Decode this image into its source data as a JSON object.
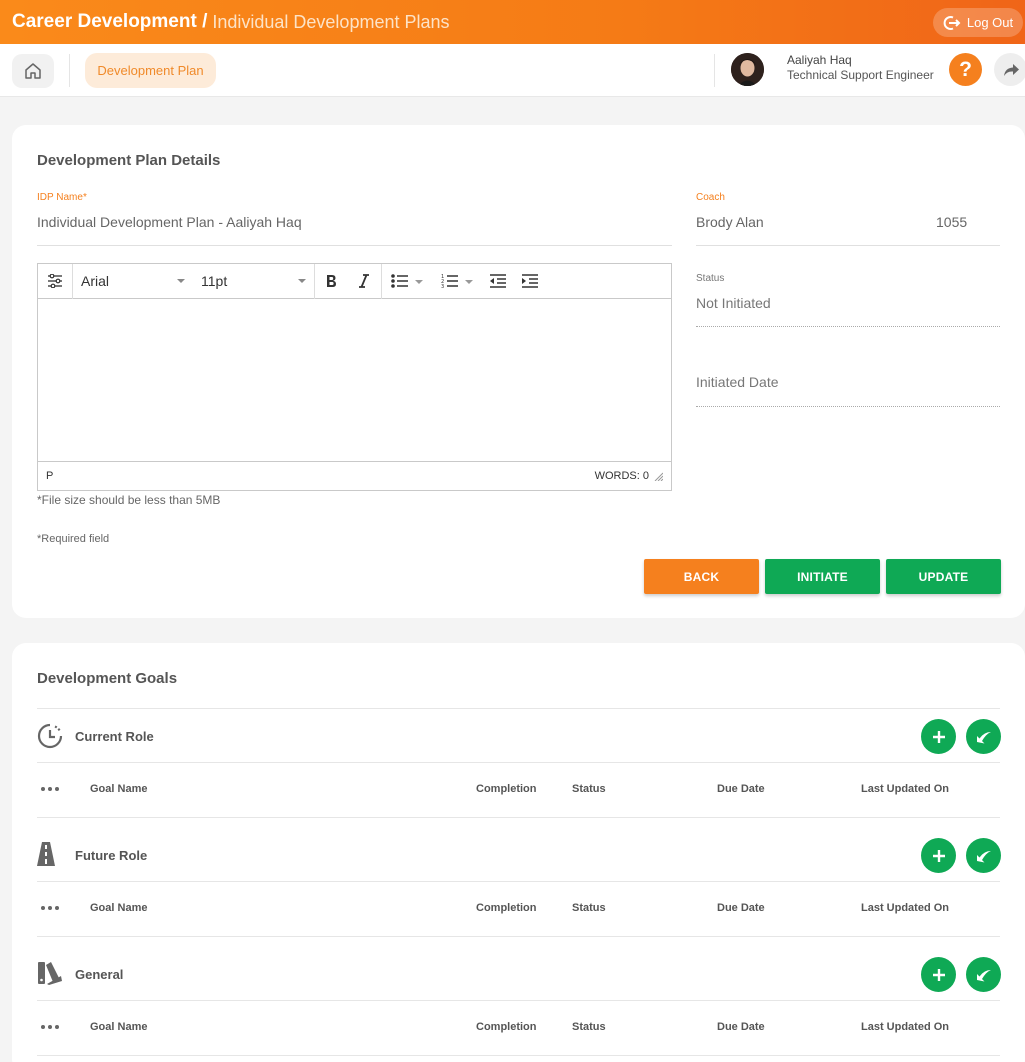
{
  "header": {
    "title": "Career Development /",
    "subtitle": "Individual Development Plans",
    "logout_label": "Log Out"
  },
  "subbar": {
    "tab_label": "Development Plan",
    "user_name": "Aaliyah Haq",
    "user_role": "Technical Support Engineer",
    "help_label": "?"
  },
  "plan": {
    "title": "Development Plan Details",
    "idp_label": "IDP Name*",
    "idp_value": "Individual Development Plan - Aaliyah Haq",
    "coach_label": "Coach",
    "coach_name": "Brody Alan",
    "coach_id": "1055",
    "status_label": "Status",
    "status_value": "Not Initiated",
    "initiated_placeholder": "Initiated Date",
    "editor": {
      "font": "Arial",
      "size": "11pt",
      "path": "P",
      "words": "WORDS: 0"
    },
    "file_note": "*File size should be less than 5MB",
    "required_note": "*Required field",
    "buttons": {
      "back": "BACK",
      "initiate": "INITIATE",
      "update": "UPDATE"
    }
  },
  "goals": {
    "title": "Development Goals",
    "columns": [
      "Goal Name",
      "Completion",
      "Status",
      "Due Date",
      "Last Updated On"
    ],
    "sections": [
      {
        "title": "Current Role",
        "icon": "clock-history-icon"
      },
      {
        "title": "Future Role",
        "icon": "road-icon"
      },
      {
        "title": "General",
        "icon": "swatch-icon"
      }
    ]
  },
  "colors": {
    "accent": "#f5801e",
    "green": "#0fa955"
  }
}
